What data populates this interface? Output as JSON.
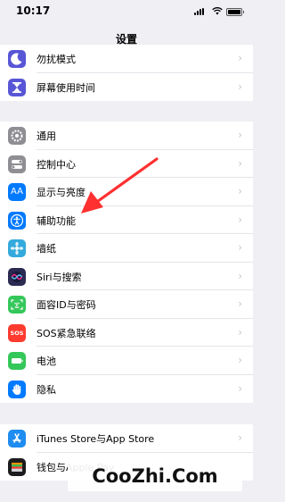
{
  "status_bar": {
    "time": "10:17"
  },
  "header": {
    "title": "设置"
  },
  "groups": [
    {
      "items": [
        {
          "label": "勿扰模式",
          "icon": "moon-icon",
          "color": "#5856d6"
        },
        {
          "label": "屏幕使用时间",
          "icon": "hourglass-icon",
          "color": "#5856d6"
        }
      ]
    },
    {
      "items": [
        {
          "label": "通用",
          "icon": "gear-icon",
          "color": "#8e8e93"
        },
        {
          "label": "控制中心",
          "icon": "toggles-icon",
          "color": "#8e8e93"
        },
        {
          "label": "显示与亮度",
          "icon": "text-size-icon",
          "icon_text": "AA",
          "color": "#007aff"
        },
        {
          "label": "辅助功能",
          "icon": "accessibility-icon",
          "color": "#007aff"
        },
        {
          "label": "墙纸",
          "icon": "wallpaper-icon",
          "color": "#34aadc"
        },
        {
          "label": "Siri与搜索",
          "icon": "siri-icon",
          "color": "#2b2b52"
        },
        {
          "label": "面容ID与密码",
          "icon": "face-id-icon",
          "color": "#34c759"
        },
        {
          "label": "SOS紧急联络",
          "icon": "sos-icon",
          "icon_text": "SOS",
          "color": "#ff3b30"
        },
        {
          "label": "电池",
          "icon": "battery-icon",
          "color": "#34c759"
        },
        {
          "label": "隐私",
          "icon": "hand-icon",
          "color": "#007aff"
        }
      ]
    },
    {
      "items": [
        {
          "label": "iTunes Store与App Store",
          "icon": "app-store-icon",
          "color": "#1e8cf0"
        },
        {
          "label": "钱包与Apple Pay",
          "icon": "wallet-icon",
          "color": "#1c1c1e"
        }
      ]
    }
  ],
  "watermark": {
    "text": "CooZhi.Com"
  }
}
